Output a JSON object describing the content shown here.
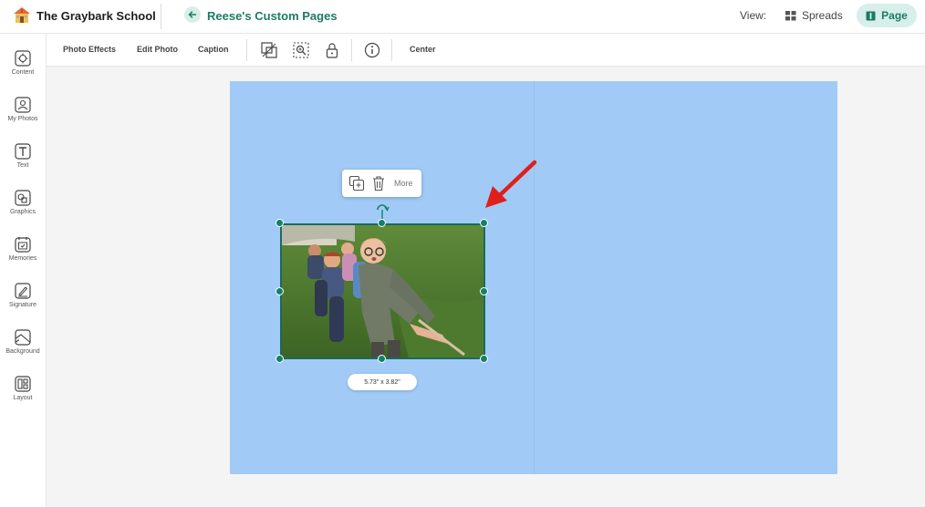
{
  "header": {
    "school_name": "The Graybark School",
    "project_title": "Reese's Custom Pages",
    "view_label": "View:",
    "spreads_label": "Spreads",
    "page_label": "Page"
  },
  "sidebar": {
    "items": [
      {
        "label": "Content",
        "icon": "content-icon"
      },
      {
        "label": "My Photos",
        "icon": "my-photos-icon"
      },
      {
        "label": "Text",
        "icon": "text-icon"
      },
      {
        "label": "Graphics",
        "icon": "graphics-icon"
      },
      {
        "label": "Memories",
        "icon": "memories-icon"
      },
      {
        "label": "Signature",
        "icon": "signature-icon"
      },
      {
        "label": "Background",
        "icon": "background-icon"
      },
      {
        "label": "Layout",
        "icon": "layout-icon"
      }
    ]
  },
  "toolbar": {
    "photo_effects": "Photo Effects",
    "edit_photo": "Edit Photo",
    "caption": "Caption",
    "center": "Center"
  },
  "floating_toolbar": {
    "more_label": "More"
  },
  "selection": {
    "size_label": "5.73\" x 3.82\""
  },
  "colors": {
    "accent": "#1e7a63",
    "page_background": "#a1cbf6",
    "handle": "#13816a",
    "annotation_arrow": "#e0201b"
  }
}
